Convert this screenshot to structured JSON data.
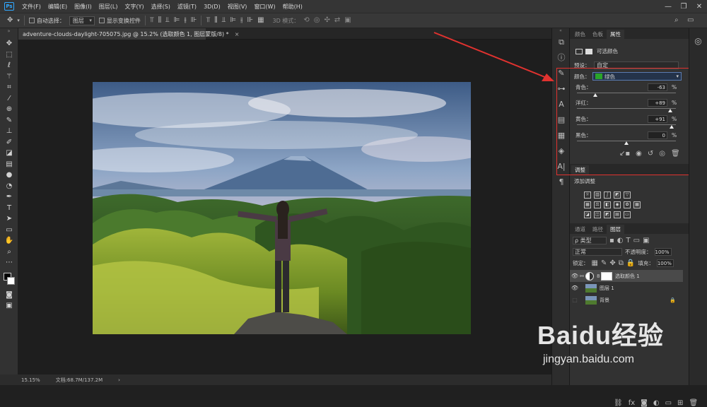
{
  "menubar": {
    "logo": "Ps",
    "items": [
      "文件(F)",
      "编辑(E)",
      "图像(I)",
      "图层(L)",
      "文字(Y)",
      "选择(S)",
      "滤镜(T)",
      "3D(D)",
      "视图(V)",
      "窗口(W)",
      "帮助(H)"
    ],
    "minimize": "—",
    "restore": "❐",
    "close": "✕"
  },
  "options": {
    "auto_select_label": "自动选择：",
    "auto_select_value": "图层",
    "show_transform_label": "显示变换控件",
    "mode3d_label": "3D 模式："
  },
  "document": {
    "tab_title": "adventure-clouds-daylight-705075.jpg @ 15.2% (选取颜色 1, 图层蒙版/8) *",
    "tab_close": "×"
  },
  "status": {
    "zoom": "15.15%",
    "doc_size": "文档:68.7M/137.2M"
  },
  "properties": {
    "tabs": [
      "颜色",
      "色板",
      "属性"
    ],
    "active_tab_index": 2,
    "title": "可选颜色",
    "preset_label": "预设：",
    "preset_value": "自定",
    "colors_label": "颜色：",
    "colors_value": "绿色",
    "colors_swatch": "#2aa52a",
    "sliders": [
      {
        "label": "青色：",
        "value": "-63",
        "unit": "%",
        "fraction": 0.185
      },
      {
        "label": "洋红：",
        "value": "+89",
        "unit": "%",
        "fraction": 0.945
      },
      {
        "label": "黄色：",
        "value": "+91",
        "unit": "%",
        "fraction": 0.955
      },
      {
        "label": "黑色：",
        "value": "0",
        "unit": "%",
        "fraction": 0.5
      }
    ]
  },
  "adjustments": {
    "tab": "调整",
    "add_label": "添加调整"
  },
  "layers": {
    "tabs": [
      "通道",
      "路径",
      "图层"
    ],
    "active_tab_index": 2,
    "filter_value": "ρ 类型",
    "blend_mode": "正常",
    "opacity_label": "不透明度：",
    "opacity_value": "100%",
    "lock_label": "锁定：",
    "fill_label": "填充：",
    "fill_value": "100%",
    "rows": [
      {
        "name": "选取颜色 1",
        "visible": true,
        "selected": true
      },
      {
        "name": "图层 1",
        "visible": true,
        "selected": false
      },
      {
        "name": "背景",
        "visible": false,
        "selected": false
      }
    ]
  },
  "watermark": {
    "brand": "Baidu经验",
    "url": "jingyan.baidu.com"
  },
  "colors": {
    "annotation_red": "#e0322f",
    "ps_blue": "#31a8ff"
  }
}
